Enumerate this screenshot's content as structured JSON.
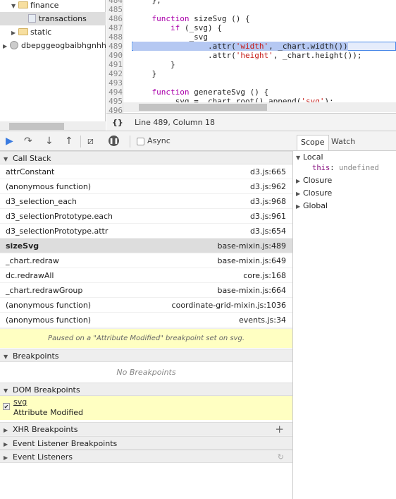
{
  "navigator": {
    "items": [
      {
        "label": "finance"
      },
      {
        "label": "transactions"
      },
      {
        "label": "static"
      },
      {
        "label": "dbepggeogbaibhgnhh"
      }
    ]
  },
  "editor": {
    "lines": [
      {
        "n": "484",
        "text": "    };"
      },
      {
        "n": "485",
        "text": ""
      },
      {
        "n": "486",
        "kw": "function",
        "text": " sizeSvg () {",
        "indent": "    "
      },
      {
        "n": "487",
        "kw": "if",
        "text": " (_svg) {",
        "indent": "        "
      },
      {
        "n": "488",
        "text": "            _svg"
      },
      {
        "n": "489",
        "pre": "                .attr(",
        "str": "'width'",
        "post": ", _chart.width())"
      },
      {
        "n": "490",
        "pre": "                .attr(",
        "str": "'height'",
        "post": ", _chart.height());"
      },
      {
        "n": "491",
        "text": "        }"
      },
      {
        "n": "492",
        "text": "    }"
      },
      {
        "n": "493",
        "text": ""
      },
      {
        "n": "494",
        "kw": "function",
        "text": " generateSvg () {",
        "indent": "    "
      },
      {
        "n": "495",
        "pre": "        _svg = _chart.root().append(",
        "str": "'svg'",
        "post": ");"
      },
      {
        "n": "496",
        "text": ""
      }
    ]
  },
  "status": {
    "format_icon": "{}",
    "position": "Line 489, Column 18"
  },
  "toolbar": {
    "async_label": "Async",
    "async_checked": false
  },
  "call_stack": {
    "title": "Call Stack",
    "frames": [
      {
        "fn": "attrConstant",
        "loc": "d3.js:665"
      },
      {
        "fn": "(anonymous function)",
        "loc": "d3.js:962"
      },
      {
        "fn": "d3_selection_each",
        "loc": "d3.js:968"
      },
      {
        "fn": "d3_selectionPrototype.each",
        "loc": "d3.js:961"
      },
      {
        "fn": "d3_selectionPrototype.attr",
        "loc": "d3.js:654"
      },
      {
        "fn": "sizeSvg",
        "loc": "base-mixin.js:489",
        "current": true
      },
      {
        "fn": "_chart.redraw",
        "loc": "base-mixin.js:649"
      },
      {
        "fn": "dc.redrawAll",
        "loc": "core.js:168"
      },
      {
        "fn": "_chart.redrawGroup",
        "loc": "base-mixin.js:664"
      },
      {
        "fn": "(anonymous function)",
        "loc": "coordinate-grid-mixin.js:1036"
      },
      {
        "fn": "(anonymous function)",
        "loc": "events.js:34"
      }
    ]
  },
  "paused_message": "Paused on a \"Attribute Modified\" breakpoint set on svg.",
  "breakpoints": {
    "title": "Breakpoints",
    "empty": "No Breakpoints"
  },
  "dom_breakpoints": {
    "title": "DOM Breakpoints",
    "node": "svg",
    "type": "Attribute Modified",
    "checked": true
  },
  "sections": [
    "XHR Breakpoints",
    "Event Listener Breakpoints",
    "Event Listeners"
  ],
  "scope": {
    "tabs": [
      "Scope",
      "Watch"
    ],
    "local": "Local",
    "this_key": "this",
    "this_val": "undefined",
    "items": [
      "Closure",
      "Closure",
      "Global"
    ]
  }
}
